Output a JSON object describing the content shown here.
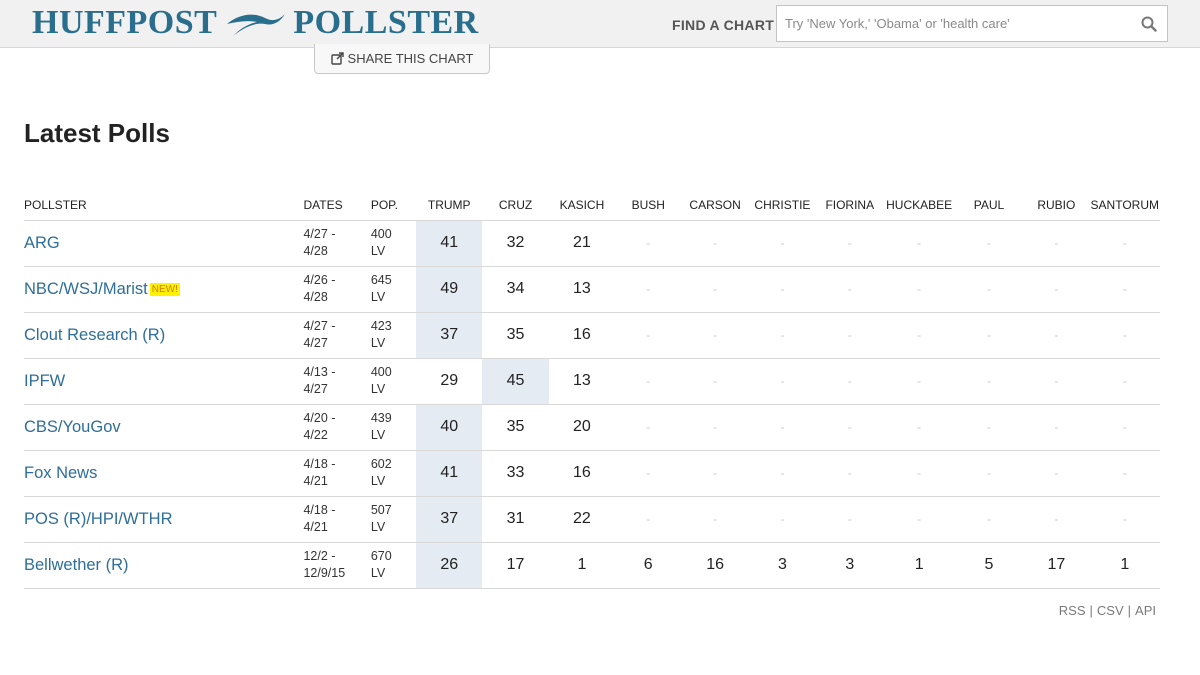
{
  "header": {
    "logo_left": "HUFFPOST",
    "logo_right": "POLLSTER",
    "find_label": "FIND A CHART",
    "search_placeholder": "Try 'New York,' 'Obama' or 'health care'",
    "search_value": ""
  },
  "share_label": "SHARE THIS CHART",
  "section_title": "Latest Polls",
  "columns": {
    "pollster": "POLLSTER",
    "dates": "DATES",
    "pop": "POP.",
    "candidates": [
      "TRUMP",
      "CRUZ",
      "KASICH",
      "BUSH",
      "CARSON",
      "CHRISTIE",
      "FIORINA",
      "HUCKABEE",
      "PAUL",
      "RUBIO",
      "SANTORUM"
    ]
  },
  "polls": [
    {
      "pollster": "ARG",
      "new": "",
      "date_start": "4/27 -",
      "date_end": "4/28",
      "pop_n": "400",
      "pop_type": "LV",
      "values": [
        "41",
        "32",
        "21",
        "-",
        "-",
        "-",
        "-",
        "-",
        "-",
        "-",
        "-"
      ],
      "highlight_col": 0
    },
    {
      "pollster": "NBC/WSJ/Marist",
      "new": "NEW!",
      "date_start": "4/26 -",
      "date_end": "4/28",
      "pop_n": "645",
      "pop_type": "LV",
      "values": [
        "49",
        "34",
        "13",
        "-",
        "-",
        "-",
        "-",
        "-",
        "-",
        "-",
        "-"
      ],
      "highlight_col": 0
    },
    {
      "pollster": "Clout Research (R)",
      "new": "",
      "date_start": "4/27 -",
      "date_end": "4/27",
      "pop_n": "423",
      "pop_type": "LV",
      "values": [
        "37",
        "35",
        "16",
        "-",
        "-",
        "-",
        "-",
        "-",
        "-",
        "-",
        "-"
      ],
      "highlight_col": 0
    },
    {
      "pollster": "IPFW",
      "new": "",
      "date_start": "4/13 -",
      "date_end": "4/27",
      "pop_n": "400",
      "pop_type": "LV",
      "values": [
        "29",
        "45",
        "13",
        "-",
        "-",
        "-",
        "-",
        "-",
        "-",
        "-",
        "-"
      ],
      "highlight_col": 1
    },
    {
      "pollster": "CBS/YouGov",
      "new": "",
      "date_start": "4/20 -",
      "date_end": "4/22",
      "pop_n": "439",
      "pop_type": "LV",
      "values": [
        "40",
        "35",
        "20",
        "-",
        "-",
        "-",
        "-",
        "-",
        "-",
        "-",
        "-"
      ],
      "highlight_col": 0
    },
    {
      "pollster": "Fox News",
      "new": "",
      "date_start": "4/18 -",
      "date_end": "4/21",
      "pop_n": "602",
      "pop_type": "LV",
      "values": [
        "41",
        "33",
        "16",
        "-",
        "-",
        "-",
        "-",
        "-",
        "-",
        "-",
        "-"
      ],
      "highlight_col": 0
    },
    {
      "pollster": "POS (R)/HPI/WTHR",
      "new": "",
      "date_start": "4/18 -",
      "date_end": "4/21",
      "pop_n": "507",
      "pop_type": "LV",
      "values": [
        "37",
        "31",
        "22",
        "-",
        "-",
        "-",
        "-",
        "-",
        "-",
        "-",
        "-"
      ],
      "highlight_col": 0
    },
    {
      "pollster": "Bellwether (R)",
      "new": "",
      "date_start": "12/2 -",
      "date_end": "12/9/15",
      "pop_n": "670",
      "pop_type": "LV",
      "values": [
        "26",
        "17",
        "1",
        "6",
        "16",
        "3",
        "3",
        "1",
        "5",
        "17",
        "1"
      ],
      "highlight_col": 0,
      "date_linked": true
    }
  ],
  "footer": {
    "rss": "RSS",
    "csv": "CSV",
    "api": "API",
    "separator": "|"
  },
  "colors": {
    "brand": "#2a6e8e",
    "link": "#2e6e9a",
    "highlight": "#e5ebf2",
    "new_badge_bg": "#fff200"
  }
}
